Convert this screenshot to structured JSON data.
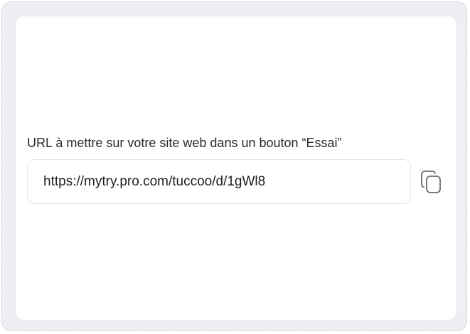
{
  "url_field": {
    "label": "URL à mettre sur votre site web dans un bouton “Essai”",
    "value": "https://mytry.pro.com/tuccoo/d/1gWl8"
  },
  "icons": {
    "copy": "copy-icon"
  }
}
